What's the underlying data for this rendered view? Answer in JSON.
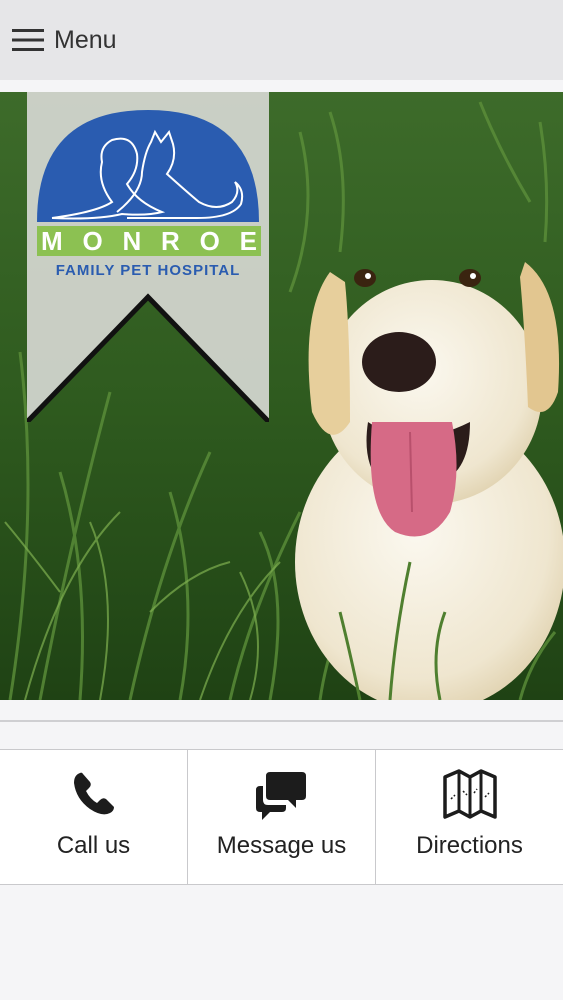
{
  "header": {
    "menu_label": "Menu",
    "menu_icon": "hamburger-icon"
  },
  "hero": {
    "logo_word": [
      "M",
      "O",
      "N",
      "R",
      "O",
      "E"
    ],
    "logo_subtitle": "FAMILY PET HOSPITAL",
    "colors": {
      "logo_blue": "#2a5cb0",
      "logo_green": "#8cc152",
      "banner": "#d6d8d2"
    }
  },
  "actions": [
    {
      "label": "Call us",
      "icon": "phone-icon"
    },
    {
      "label": "Message us",
      "icon": "chat-bubbles-icon"
    },
    {
      "label": "Directions",
      "icon": "map-icon"
    }
  ]
}
